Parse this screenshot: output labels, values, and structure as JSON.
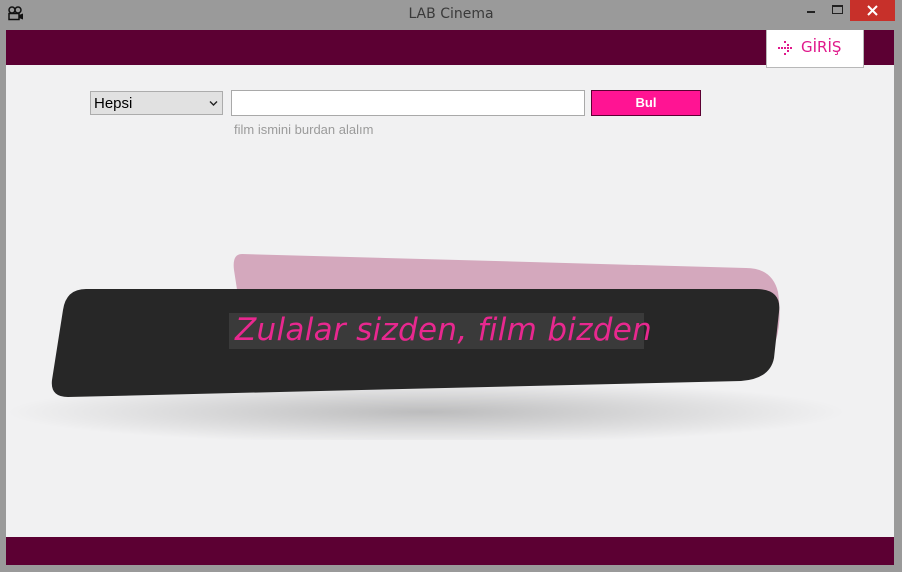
{
  "window": {
    "title": "LAB Cinema",
    "app_icon": "film-camera-icon",
    "controls": [
      "minimize-icon",
      "maximize-icon",
      "close-icon"
    ]
  },
  "header": {
    "login_label": "GİRİŞ",
    "login_icon": "sign-in-arrow-icon"
  },
  "search": {
    "category_value": "Hepsi",
    "query_value": "",
    "hint": "film ismini burdan alalım",
    "button_label": "Bul"
  },
  "banner": {
    "slogan": "Zulalar sizden, film bizden"
  },
  "colors": {
    "brand_dark": "#5c0033",
    "accent_pink": "#ff1493",
    "banner_back": "#d4a8bd",
    "banner_front": "#272727"
  }
}
